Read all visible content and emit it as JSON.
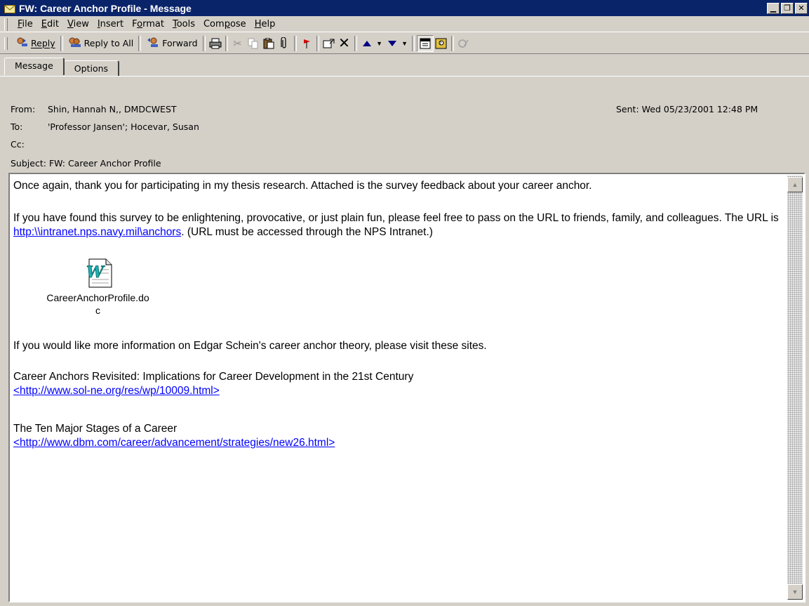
{
  "window": {
    "title": "FW: Career Anchor Profile - Message",
    "controls": [
      "minimize",
      "maximize",
      "close"
    ]
  },
  "menu": [
    {
      "label": "File",
      "key": "F",
      "rest": "ile"
    },
    {
      "label": "Edit",
      "key": "E",
      "rest": "dit"
    },
    {
      "label": "View",
      "key": "V",
      "rest": "iew"
    },
    {
      "label": "Insert",
      "key": "I",
      "rest": "nsert"
    },
    {
      "label": "Format",
      "pre": "F",
      "key": "o",
      "rest": "rmat"
    },
    {
      "label": "Tools",
      "key": "T",
      "rest": "ools"
    },
    {
      "label": "Compose",
      "pre": "Com",
      "key": "p",
      "rest": "ose"
    },
    {
      "label": "Help",
      "key": "H",
      "rest": "elp"
    }
  ],
  "toolbar": {
    "reply": "Reply",
    "reply_all": "Reply to All",
    "forward": "Forward",
    "icons": [
      "print-icon",
      "cut-icon",
      "copy-icon",
      "paste-icon",
      "attach-icon",
      "flag-icon",
      "move-to-folder-icon",
      "delete-icon",
      "previous-item-icon",
      "next-item-icon",
      "message-header-icon",
      "address-book-icon",
      "check-names-icon"
    ]
  },
  "tabs": {
    "message": "Message",
    "options": "Options"
  },
  "header": {
    "from_label": "From:",
    "from": "Shin, Hannah N,, DMDCWEST",
    "to_label": "To:",
    "to": "'Professor Jansen'; Hocevar, Susan",
    "cc_label": "Cc:",
    "cc": "",
    "subject_label": "Subject:",
    "subject": "FW: Career Anchor Profile",
    "sent_label": "Sent:",
    "sent": "Wed 05/23/2001 12:48 PM"
  },
  "body": {
    "p1": "Once again, thank you for participating in my thesis research.  Attached is the survey feedback about your career anchor.",
    "p2_a": "If you have found this survey to be enlightening, provocative, or just plain fun, please feel free to pass on the URL to friends, family, and colleagues.  The URL is ",
    "p2_link": "http:\\\\intranet.nps.navy.mil\\anchors",
    "p2_b": ".  (URL must be accessed through the NPS Intranet.)",
    "attachment_name_1": "CareerAnchorProfile.do",
    "attachment_name_2": "c",
    "p3": "If you would like more information on Edgar Schein's career anchor theory, please visit these sites.",
    "link1_title": "Career Anchors Revisited: Implications for Career Development in the 21st Century",
    "link1_url": "<http://www.sol-ne.org/res/wp/10009.html>",
    "link2_title": "The Ten Major Stages of a Career",
    "link2_url": "<http://www.dbm.com/career/advancement/strategies/new26.html>"
  },
  "colors": {
    "titlebar": "#0a246a",
    "chrome": "#d4d0c8",
    "link": "#0000ff"
  }
}
